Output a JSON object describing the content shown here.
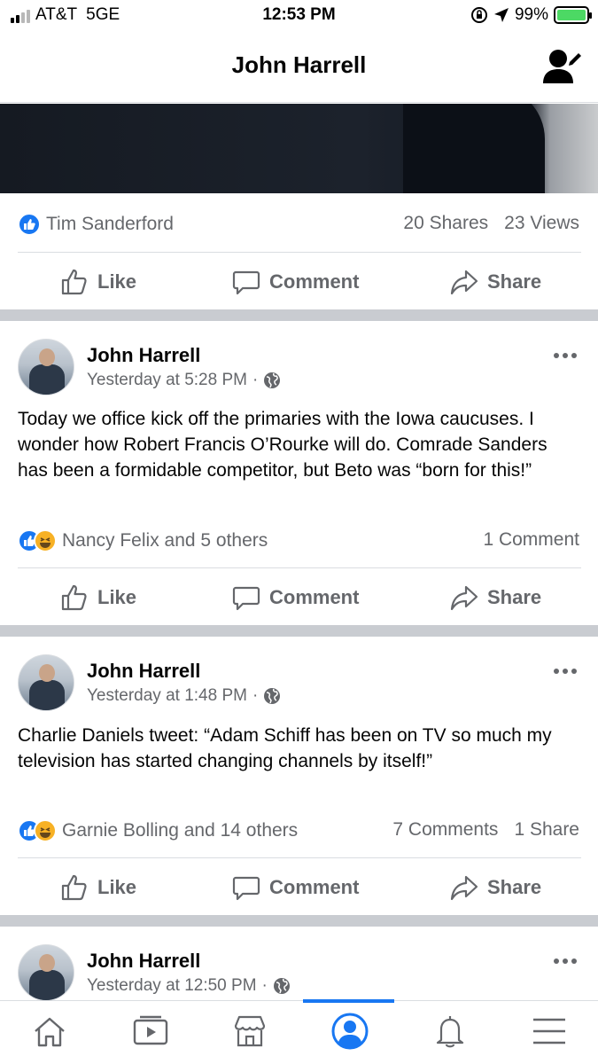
{
  "status_bar": {
    "carrier": "AT&T",
    "network": "5GE",
    "time": "12:53 PM",
    "battery": "99%",
    "battery_level": 0.99
  },
  "header": {
    "title": "John Harrell",
    "edit_icon": "person-edit-icon"
  },
  "video_post": {
    "liker": "Tim Sanderford",
    "shares": "20 Shares",
    "views": "23 Views"
  },
  "actions": {
    "like": "Like",
    "comment": "Comment",
    "share": "Share"
  },
  "posts": [
    {
      "author": "John Harrell",
      "time": "Yesterday at 5:28 PM",
      "separator": "·",
      "text": "Today we office kick off the primaries with the Iowa caucuses. I wonder how Robert Francis O’Rourke will do. Comrade Sanders has been a formidable competitor, but Beto was “born for this!”",
      "reactors": "Nancy Felix and 5 others",
      "comments": "1 Comment",
      "shares": ""
    },
    {
      "author": "John Harrell",
      "time": "Yesterday at 1:48 PM",
      "separator": "·",
      "text": "Charlie Daniels tweet: “Adam Schiff has been on TV so much my television has started changing channels by itself!”",
      "reactors": "Garnie Bolling and 14 others",
      "comments": "7 Comments",
      "shares": "1 Share"
    },
    {
      "author": "John Harrell",
      "time": "Yesterday at 12:50 PM",
      "separator": "·",
      "text": "",
      "reactors": "",
      "comments": "",
      "shares": ""
    }
  ],
  "bottom_nav": {
    "items": [
      "home-icon",
      "watch-icon",
      "marketplace-icon",
      "profile-icon",
      "notifications-icon",
      "menu-icon"
    ],
    "active": "profile-icon"
  },
  "colors": {
    "accent": "#1877f2",
    "secondary_text": "#65676b",
    "separator": "#c9ccd1",
    "battery_green": "#4cd964"
  }
}
